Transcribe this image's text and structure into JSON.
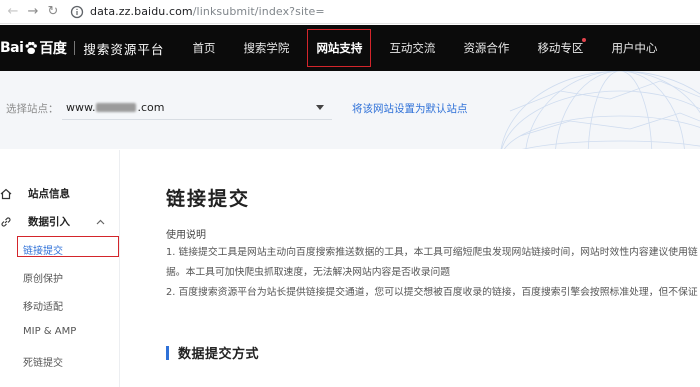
{
  "browser": {
    "url_host": "data.zz.baidu.com",
    "url_path": "/linksubmit/index?site="
  },
  "topbar": {
    "logo_text_left": "Bai",
    "logo_text_right": "百度",
    "platform_name": "搜索资源平台",
    "nav": [
      {
        "label": "首页"
      },
      {
        "label": "搜索学院"
      },
      {
        "label": "网站支持"
      },
      {
        "label": "互动交流"
      },
      {
        "label": "资源合作"
      },
      {
        "label": "移动专区"
      },
      {
        "label": "用户中心"
      }
    ]
  },
  "site_selector": {
    "label": "选择站点：",
    "value_prefix": "www.",
    "value_suffix": ".com",
    "set_default_link": "将该网站设置为默认站点"
  },
  "sidebar": {
    "site_info": "站点信息",
    "data_import": "数据引入",
    "sub_items": [
      "链接提交",
      "原创保护",
      "移动适配",
      "MIP & AMP",
      "死链提交"
    ]
  },
  "main": {
    "title": "链接提交",
    "usage_heading": "使用说明",
    "usage_lines": [
      "1. 链接提交工具是网站主动向百度搜索推送数据的工具，本工具可缩短爬虫发现网站链接时间，网站时效性内容建议使用链",
      "据。本工具可加快爬虫抓取速度，无法解决网站内容是否收录问题",
      "2. 百度搜索资源平台为站长提供链接提交通道，您可以提交想被百度收录的链接，百度搜索引擎会按照标准处理，但不保证"
    ],
    "section_title": "数据提交方式"
  },
  "colors": {
    "accent_blue": "#2f71d8",
    "highlight_red": "#d3252b",
    "topbar_bg": "#0b0b0b"
  }
}
